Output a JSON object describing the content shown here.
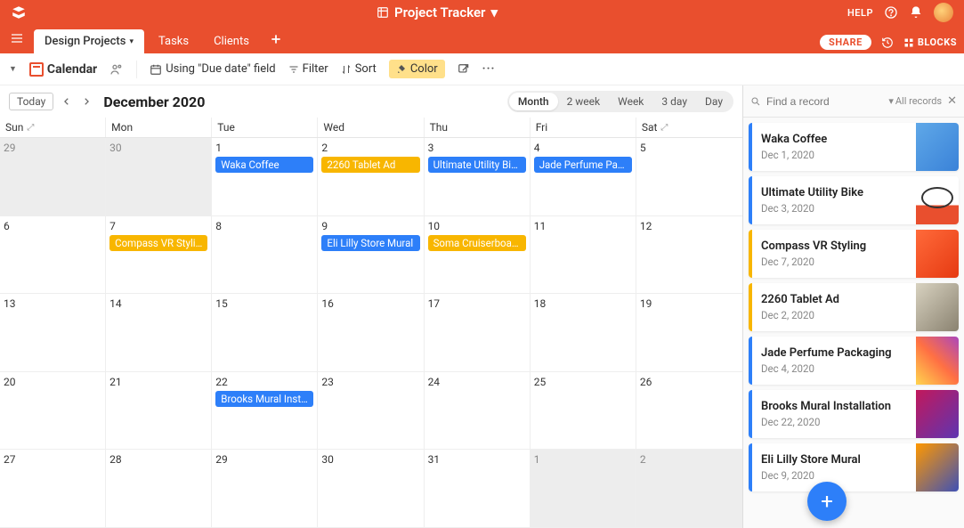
{
  "topbar": {
    "title": "Project Tracker",
    "help": "HELP"
  },
  "tabs": {
    "items": [
      {
        "label": "Design Projects",
        "active": true
      },
      {
        "label": "Tasks",
        "active": false
      },
      {
        "label": "Clients",
        "active": false
      }
    ],
    "share": "SHARE",
    "blocks": "BLOCKS"
  },
  "toolbar": {
    "view_label": "Calendar",
    "using": "Using \"Due date\" field",
    "filter": "Filter",
    "sort": "Sort",
    "color": "Color"
  },
  "calendar": {
    "today": "Today",
    "title": "December 2020",
    "ranges": [
      "Month",
      "2 week",
      "Week",
      "3 day",
      "Day"
    ],
    "active_range": "Month",
    "day_headers": [
      "Sun",
      "Mon",
      "Tue",
      "Wed",
      "Thu",
      "Fri",
      "Sat"
    ],
    "cells": [
      {
        "n": "29",
        "other": true
      },
      {
        "n": "30",
        "other": true
      },
      {
        "n": "1",
        "events": [
          {
            "t": "Waka Coffee",
            "c": "blue"
          }
        ]
      },
      {
        "n": "2",
        "events": [
          {
            "t": "2260 Tablet Ad",
            "c": "yellow"
          }
        ]
      },
      {
        "n": "3",
        "events": [
          {
            "t": "Ultimate Utility Bike",
            "c": "blue"
          }
        ]
      },
      {
        "n": "4",
        "events": [
          {
            "t": "Jade Perfume Pac…",
            "c": "blue"
          }
        ]
      },
      {
        "n": "5"
      },
      {
        "n": "6"
      },
      {
        "n": "7",
        "events": [
          {
            "t": "Compass VR Styli…",
            "c": "yellow"
          }
        ]
      },
      {
        "n": "8"
      },
      {
        "n": "9",
        "events": [
          {
            "t": "Eli Lilly Store Mural",
            "c": "blue"
          }
        ]
      },
      {
        "n": "10",
        "events": [
          {
            "t": "Soma Cruiserboard",
            "c": "yellow"
          }
        ]
      },
      {
        "n": "11"
      },
      {
        "n": "12"
      },
      {
        "n": "13"
      },
      {
        "n": "14"
      },
      {
        "n": "15"
      },
      {
        "n": "16"
      },
      {
        "n": "17"
      },
      {
        "n": "18"
      },
      {
        "n": "19"
      },
      {
        "n": "20"
      },
      {
        "n": "21"
      },
      {
        "n": "22",
        "events": [
          {
            "t": "Brooks Mural Inst…",
            "c": "blue"
          }
        ]
      },
      {
        "n": "23"
      },
      {
        "n": "24"
      },
      {
        "n": "25"
      },
      {
        "n": "26"
      },
      {
        "n": "27"
      },
      {
        "n": "28"
      },
      {
        "n": "29"
      },
      {
        "n": "30"
      },
      {
        "n": "31"
      },
      {
        "n": "1",
        "other": true
      },
      {
        "n": "2",
        "other": true
      }
    ]
  },
  "sidebar": {
    "search_placeholder": "Find a record",
    "all_records": "All records",
    "records": [
      {
        "title": "Waka Coffee",
        "date": "Dec 1, 2020",
        "color": "blue",
        "thumb": "th0"
      },
      {
        "title": "Ultimate Utility Bike",
        "date": "Dec 3, 2020",
        "color": "blue",
        "thumb": "th1"
      },
      {
        "title": "Compass VR Styling",
        "date": "Dec 7, 2020",
        "color": "yellow",
        "thumb": "th2"
      },
      {
        "title": "2260 Tablet Ad",
        "date": "Dec 2, 2020",
        "color": "yellow",
        "thumb": "th3"
      },
      {
        "title": "Jade Perfume Packaging",
        "date": "Dec 4, 2020",
        "color": "blue",
        "thumb": "th4"
      },
      {
        "title": "Brooks Mural Installation",
        "date": "Dec 22, 2020",
        "color": "blue",
        "thumb": "th5"
      },
      {
        "title": "Eli Lilly Store Mural",
        "date": "Dec 9, 2020",
        "color": "blue",
        "thumb": "th6"
      }
    ]
  }
}
